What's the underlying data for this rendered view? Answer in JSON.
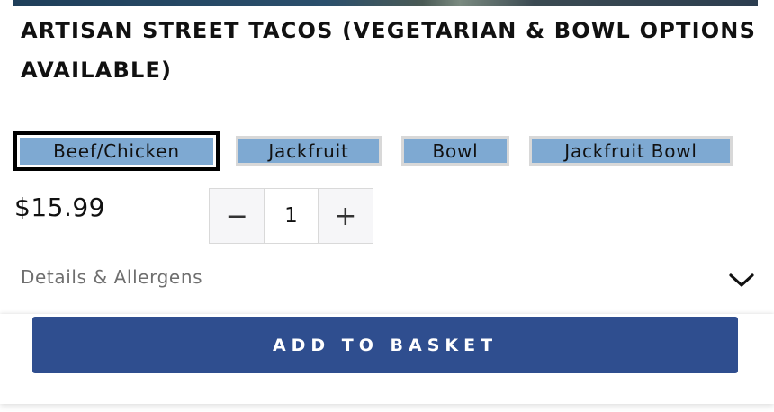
{
  "product": {
    "title": "ARTISAN STREET TACOS (VEGETARIAN & BOWL OPTIONS AVAILABLE)",
    "price": "$15.99"
  },
  "options": [
    {
      "label": "Beef/Chicken",
      "selected": true
    },
    {
      "label": "Jackfruit",
      "selected": false
    },
    {
      "label": "Bowl",
      "selected": false
    },
    {
      "label": "Jackfruit Bowl",
      "selected": false
    }
  ],
  "quantity": {
    "decrement": "−",
    "value": "1",
    "increment": "+"
  },
  "details": {
    "label": "Details & Allergens",
    "icon": "chevron-down-icon"
  },
  "actions": {
    "add_to_basket": "ADD TO BASKET"
  },
  "colors": {
    "option_fill": "#7ea9d2",
    "button_primary": "#2f4e8f",
    "text": "#111111",
    "muted_text": "#6f6f6f"
  }
}
